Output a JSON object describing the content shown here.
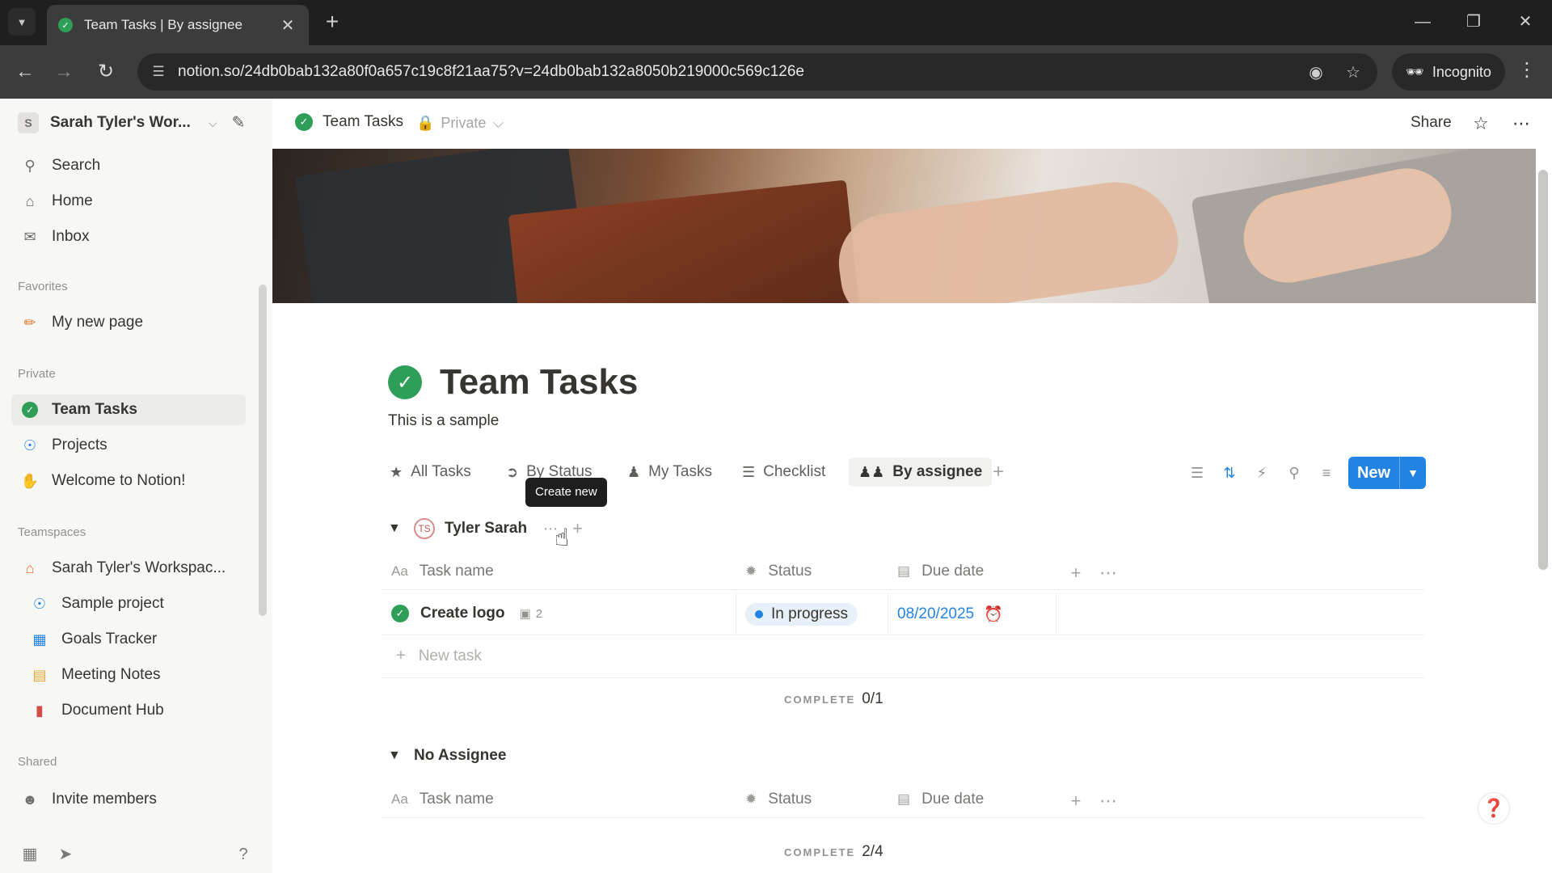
{
  "browser": {
    "tab_title": "Team Tasks | By assignee",
    "url": "notion.so/24db0bab132a80f0a657c19c8f21aa75?v=24db0bab132a8050b219000c569c126e",
    "incognito_label": "Incognito"
  },
  "sidebar": {
    "workspace_badge": "S",
    "workspace_name": "Sarah Tyler's Wor...",
    "nav": [
      {
        "label": "Search",
        "icon": "search-icon"
      },
      {
        "label": "Home",
        "icon": "home-icon"
      },
      {
        "label": "Inbox",
        "icon": "inbox-icon"
      }
    ],
    "favorites_heading": "Favorites",
    "favorites": [
      {
        "label": "My new page",
        "icon": "pencil-icon"
      }
    ],
    "private_heading": "Private",
    "private": [
      {
        "label": "Team Tasks",
        "icon": "check-circle-icon"
      },
      {
        "label": "Projects",
        "icon": "projects-icon"
      },
      {
        "label": "Welcome to Notion!",
        "icon": "wave-icon"
      }
    ],
    "teamspaces_heading": "Teamspaces",
    "teamspaces": [
      {
        "label": "Sarah Tyler's Workspac...",
        "icon": "house-icon"
      },
      {
        "label": "Sample project",
        "icon": "projects-icon"
      },
      {
        "label": "Goals Tracker",
        "icon": "goals-icon"
      },
      {
        "label": "Meeting Notes",
        "icon": "calendar-icon"
      },
      {
        "label": "Document Hub",
        "icon": "document-icon"
      }
    ],
    "shared_heading": "Shared",
    "invite_label": "Invite members"
  },
  "topbar": {
    "page_crumb": "Team Tasks",
    "privacy": "Private",
    "share_label": "Share"
  },
  "page": {
    "title": "Team Tasks",
    "description": "This is a sample",
    "views": [
      {
        "label": "All Tasks",
        "icon": "star-icon",
        "active": false
      },
      {
        "label": "By Status",
        "icon": "status-icon",
        "active": false
      },
      {
        "label": "My Tasks",
        "icon": "person-icon",
        "active": false
      },
      {
        "label": "Checklist",
        "icon": "checklist-icon",
        "active": false
      },
      {
        "label": "By assignee",
        "icon": "people-icon",
        "active": true
      }
    ],
    "new_button": "New",
    "tooltip": "Create new"
  },
  "columns": {
    "task_name_icon": "Aa",
    "task_name": "Task name",
    "status": "Status",
    "due_date": "Due date"
  },
  "groups": [
    {
      "name": "Tyler Sarah",
      "rows": [
        {
          "name": "Create logo",
          "comments": "2",
          "status": "In progress",
          "due": "08/20/2025"
        }
      ],
      "new_task": "New task",
      "complete_label": "COMPLETE",
      "complete_value": "0/1"
    },
    {
      "name": "No Assignee",
      "complete_label": "COMPLETE",
      "complete_value": "2/4"
    }
  ],
  "colors": {
    "accent": "#2383e2",
    "check_green": "#2e9e58",
    "sidebar_bg": "#f7f7f5"
  }
}
